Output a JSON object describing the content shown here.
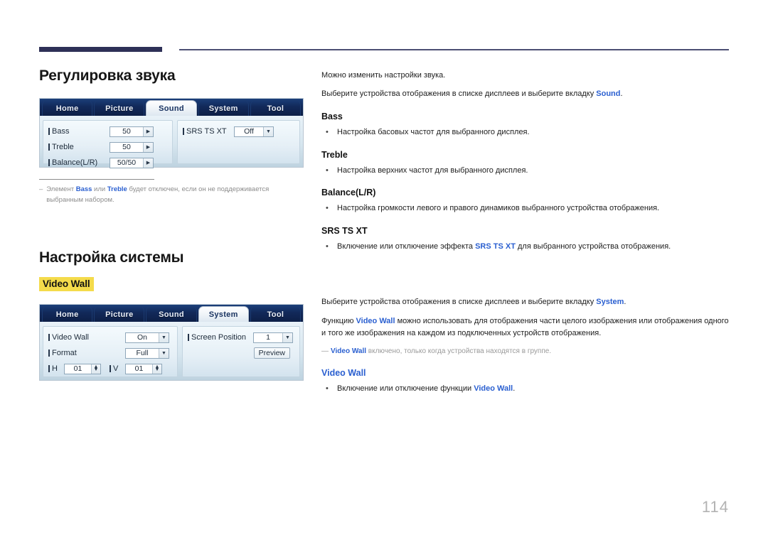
{
  "page": {
    "number": "114"
  },
  "sound_section": {
    "heading": "Регулировка звука",
    "mock": {
      "tabs": [
        {
          "label": "Home",
          "active": false
        },
        {
          "label": "Picture",
          "active": false
        },
        {
          "label": "Sound",
          "active": true
        },
        {
          "label": "System",
          "active": false
        },
        {
          "label": "Tool",
          "active": false
        }
      ],
      "left_rows": [
        {
          "label": "Bass",
          "value": "50",
          "control": "arrow"
        },
        {
          "label": "Treble",
          "value": "50",
          "control": "arrow"
        },
        {
          "label": "Balance(L/R)",
          "value": "50/50",
          "control": "arrow"
        }
      ],
      "right_rows": [
        {
          "label": "SRS TS XT",
          "value": "Off",
          "control": "dropdown"
        }
      ]
    },
    "note": {
      "dash": "–",
      "pre": "Элемент ",
      "bold1": "Bass",
      "mid": " или ",
      "bold2": "Treble",
      "post": " будет отключен, если он не поддерживается выбранным набором."
    },
    "intro1": "Можно изменить настройки звука.",
    "intro2_pre": "Выберите устройства отображения в списке дисплеев и выберите вкладку ",
    "intro2_link": "Sound",
    "intro2_post": ".",
    "items": [
      {
        "title": "Bass",
        "bullet": "Настройка басовых частот для выбранного дисплея."
      },
      {
        "title": "Treble",
        "bullet": "Настройка верхних частот для выбранного дисплея."
      },
      {
        "title": "Balance(L/R)",
        "bullet": "Настройка громкости левого и правого динамиков выбранного устройства отображения."
      }
    ],
    "srs": {
      "title": "SRS TS XT",
      "bullet_pre": "Включение или отключение эффекта ",
      "bullet_link": "SRS TS XT",
      "bullet_post": " для выбранного устройства отображения."
    }
  },
  "system_section": {
    "heading": "Настройка системы",
    "badge": "Video Wall",
    "mock": {
      "tabs": [
        {
          "label": "Home",
          "active": false
        },
        {
          "label": "Picture",
          "active": false
        },
        {
          "label": "Sound",
          "active": false
        },
        {
          "label": "System",
          "active": true
        },
        {
          "label": "Tool",
          "active": false
        }
      ],
      "left_rows": [
        {
          "label": "Video Wall",
          "value": "On",
          "control": "dropdown"
        },
        {
          "label": "Format",
          "value": "Full",
          "control": "dropdown"
        }
      ],
      "hv_row": {
        "h_label": "H",
        "h_value": "01",
        "v_label": "V",
        "v_value": "01"
      },
      "right_rows": [
        {
          "label": "Screen Position",
          "value": "1",
          "control": "dropdown"
        }
      ],
      "preview_button": "Preview"
    },
    "intro_pre": "Выберите устройства отображения в списке дисплеев и выберите вкладку ",
    "intro_link": "System",
    "intro_post": ".",
    "desc_pre": "Функцию ",
    "desc_link": "Video Wall",
    "desc_post": " можно использовать для отображения части целого изображения или отображения одного и того же изображения на каждом из подключенных устройств отображения.",
    "gray_note": {
      "dashes": "—",
      "bold": "Video Wall",
      "text": " включено, только когда устройства находятся в группе."
    },
    "vw": {
      "title": "Video Wall",
      "bullet_pre": "Включение или отключение функции ",
      "bullet_link": "Video Wall",
      "bullet_post": "."
    }
  }
}
